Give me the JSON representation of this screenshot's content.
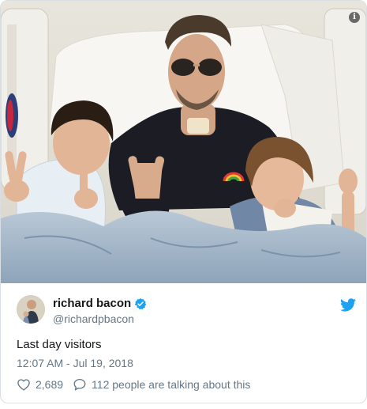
{
  "tweet": {
    "display_name": "richard bacon",
    "handle": "@richardpbacon",
    "text": "Last day visitors",
    "timestamp": "12:07 AM - Jul 19, 2018",
    "like_count": "2,689",
    "talking_text": "112 people are talking about this"
  },
  "icons": {
    "info": "info-icon",
    "verified": "verified-badge-icon",
    "brand": "twitter-bird-icon",
    "like": "heart-outline-icon",
    "reply": "speech-bubble-icon"
  },
  "colors": {
    "twitter_blue": "#1da1f2",
    "text_primary": "#14171a",
    "text_secondary": "#657786"
  }
}
